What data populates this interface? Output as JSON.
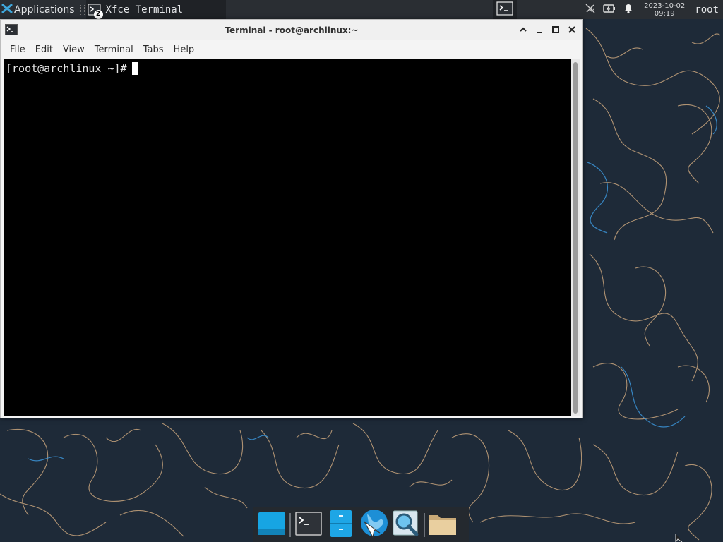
{
  "top_panel": {
    "app_menu_label": "Applications",
    "task_label": "Xfce Terminal",
    "task_badge": "2",
    "clock_date": "2023-10-02",
    "clock_time": "09:19",
    "user": "root",
    "icons": [
      "xfce-logo-icon",
      "terminal-icon",
      "network-disconnected-icon",
      "battery-charging-icon",
      "notification-bell-icon"
    ]
  },
  "terminal": {
    "title": "Terminal - root@archlinux:~",
    "menu": [
      "File",
      "Edit",
      "View",
      "Terminal",
      "Tabs",
      "Help"
    ],
    "prompt": "[root@archlinux ~]#"
  },
  "dock": {
    "items": [
      "show-desktop-icon",
      "terminal-icon",
      "file-manager-icon",
      "web-browser-icon",
      "app-finder-icon",
      "folder-icon"
    ]
  },
  "colors": {
    "wallpaper": "#1e2a38",
    "wallpaper_line_warm": "#d4a574",
    "wallpaper_line_blue": "#3a8fd0",
    "panel": "#2a2e33",
    "terminal_bg": "#000000",
    "terminal_fg": "#e6e6e6",
    "accent": "#1aa7e6"
  }
}
